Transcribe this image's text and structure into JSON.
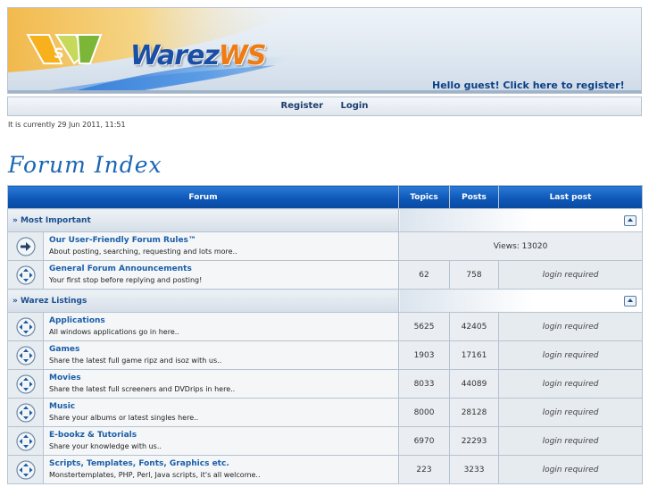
{
  "header": {
    "logo_text_part1": "Warez",
    "logo_text_part2": "WS",
    "greeting": "Hello guest! Click here to register!"
  },
  "nav": {
    "register": "Register",
    "login": "Login"
  },
  "current_time": "It is currently 29 Jun 2011, 11:51",
  "page_title": "Forum Index",
  "table": {
    "headers": {
      "forum": "Forum",
      "topics": "Topics",
      "posts": "Posts",
      "last_post": "Last post"
    },
    "categories": [
      {
        "name": "» Most Important",
        "forums": [
          {
            "title": "Our User-Friendly Forum Rules™",
            "desc": "About posting, searching, requesting and lots more..",
            "icon": "arrow-right-icon",
            "views": "Views: 13020"
          },
          {
            "title": "General Forum Announcements",
            "desc": "Your first stop before replying and posting!",
            "icon": "forum-arrows-icon",
            "topics": "62",
            "posts": "758",
            "last_post": "login required"
          }
        ]
      },
      {
        "name": "» Warez Listings",
        "forums": [
          {
            "title": "Applications",
            "desc": "All windows applications go in here..",
            "icon": "forum-arrows-icon",
            "topics": "5625",
            "posts": "42405",
            "last_post": "login required"
          },
          {
            "title": "Games",
            "desc": "Share the latest full game ripz and isoz with us..",
            "icon": "forum-arrows-icon",
            "topics": "1903",
            "posts": "17161",
            "last_post": "login required"
          },
          {
            "title": "Movies",
            "desc": "Share the latest full screeners and DVDrips in here..",
            "icon": "forum-arrows-icon",
            "topics": "8033",
            "posts": "44089",
            "last_post": "login required"
          },
          {
            "title": "Music",
            "desc": "Share your albums or latest singles here..",
            "icon": "forum-arrows-icon",
            "topics": "8000",
            "posts": "28128",
            "last_post": "login required"
          },
          {
            "title": "E-bookz & Tutorials",
            "desc": "Share your knowledge with us..",
            "icon": "forum-arrows-icon",
            "topics": "6970",
            "posts": "22293",
            "last_post": "login required"
          },
          {
            "title": "Scripts, Templates, Fonts, Graphics etc.",
            "desc": "Monstertemplates, PHP, Perl, Java scripts, it's all welcome..",
            "icon": "forum-arrows-icon",
            "topics": "223",
            "posts": "3233",
            "last_post": "login required"
          }
        ]
      }
    ]
  },
  "colors": {
    "header_blue": "#0d56b6",
    "link_blue": "#1a5ea8",
    "title_blue": "#1b66b3",
    "logo_orange": "#f07b12"
  }
}
